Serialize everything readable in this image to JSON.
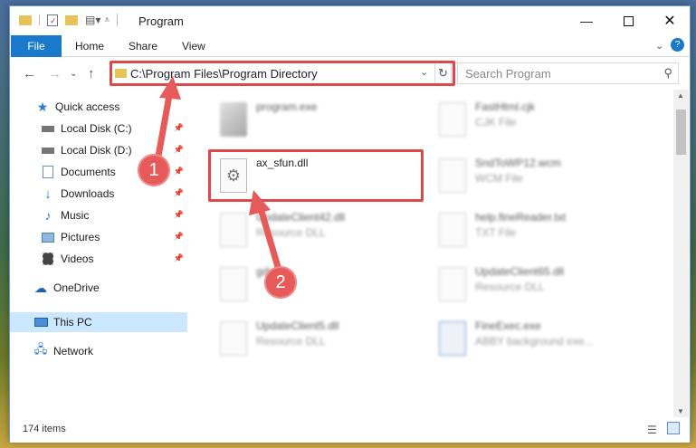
{
  "window": {
    "title": "Program"
  },
  "ribbon": {
    "tabs": [
      "File",
      "Home",
      "Share",
      "View"
    ]
  },
  "address": {
    "path": "C:\\Program Files\\Program Directory",
    "search_placeholder": "Search Program"
  },
  "sidebar": {
    "items": [
      {
        "label": "Quick access"
      },
      {
        "label": "Local Disk (C:)"
      },
      {
        "label": "Local Disk (D:)"
      },
      {
        "label": "Documents"
      },
      {
        "label": "Downloads"
      },
      {
        "label": "Music"
      },
      {
        "label": "Pictures"
      },
      {
        "label": "Videos"
      },
      {
        "label": "OneDrive"
      },
      {
        "label": "This PC"
      },
      {
        "label": "Network"
      }
    ]
  },
  "files": [
    {
      "name": "program.exe",
      "type": ""
    },
    {
      "name": "FastHtml.cjk",
      "type": "CJK File"
    },
    {
      "name": "ax_sfun.dll",
      "type": ""
    },
    {
      "name": "SndToWP12.wcm",
      "type": "WCM File"
    },
    {
      "name": "UpdateClient42.dll",
      "type": "Resource DLL"
    },
    {
      "name": "help.fineReader.txt",
      "type": "TXT File"
    },
    {
      "name": "gdi",
      "type": ""
    },
    {
      "name": "UpdateClient65.dll",
      "type": "Resource DLL"
    },
    {
      "name": "UpdateClient5.dll",
      "type": "Resource DLL"
    },
    {
      "name": "FineExec.exe",
      "type": "ABBY background exe..."
    }
  ],
  "status": {
    "item_count": "174 items"
  },
  "annotations": {
    "badge1": "1",
    "badge2": "2"
  },
  "colors": {
    "accent": "#1979ca",
    "highlight": "#e04848",
    "selected": "#cce8ff"
  }
}
